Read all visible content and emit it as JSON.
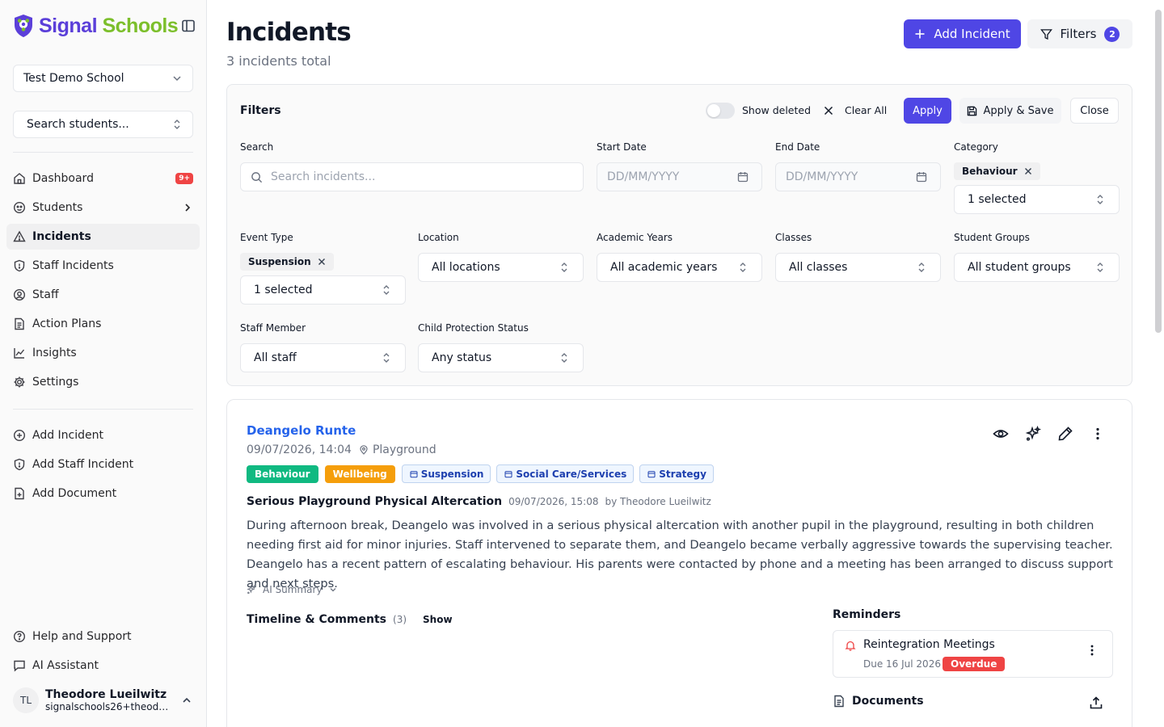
{
  "brand": {
    "name_part1": "Signal",
    "name_part2": "Schools",
    "colors": {
      "primary": "#5b3fd9",
      "secondary": "#7cbf2b"
    }
  },
  "sidebar": {
    "school_select": "Test Demo School",
    "student_search": "Search students...",
    "nav": [
      {
        "label": "Dashboard",
        "icon": "home-icon",
        "badge": "9+"
      },
      {
        "label": "Students",
        "icon": "students-icon"
      },
      {
        "label": "Incidents",
        "icon": "alert-triangle-icon",
        "active": true
      },
      {
        "label": "Staff Incidents",
        "icon": "shield-icon"
      },
      {
        "label": "Staff",
        "icon": "user-circle-icon"
      },
      {
        "label": "Action Plans",
        "icon": "file-text-icon"
      },
      {
        "label": "Insights",
        "icon": "chart-line-icon"
      },
      {
        "label": "Settings",
        "icon": "gear-icon"
      }
    ],
    "quick_actions": [
      {
        "label": "Add Incident",
        "icon": "plus-circle-icon"
      },
      {
        "label": "Add Staff Incident",
        "icon": "shield-icon"
      },
      {
        "label": "Add Document",
        "icon": "file-plus-icon"
      }
    ],
    "footer": [
      {
        "label": "Help and Support",
        "icon": "help-circle-icon"
      },
      {
        "label": "AI Assistant",
        "icon": "message-icon"
      }
    ],
    "user": {
      "initials": "TL",
      "name": "Theodore Lueilwitz",
      "email": "signalschools26+theodore@example.com"
    }
  },
  "header": {
    "title": "Incidents",
    "subtitle": "3 incidents total",
    "add_button": "Add Incident",
    "filters_button": "Filters",
    "filters_count": "2",
    "accent_color": "#4f46e5"
  },
  "filters": {
    "title": "Filters",
    "show_deleted_label": "Show deleted",
    "show_deleted": false,
    "clear_all": "Clear All",
    "apply": "Apply",
    "apply_save": "Apply & Save",
    "close": "Close",
    "search_label": "Search",
    "search_placeholder": "Search incidents...",
    "start_date_label": "Start Date",
    "start_date_placeholder": "DD/MM/YYYY",
    "end_date_label": "End Date",
    "end_date_placeholder": "DD/MM/YYYY",
    "category_label": "Category",
    "category_chip": "Behaviour",
    "category_value": "1 selected",
    "event_type_label": "Event Type",
    "event_type_chip": "Suspension",
    "event_type_value": "1 selected",
    "location_label": "Location",
    "location_value": "All locations",
    "academic_years_label": "Academic Years",
    "academic_years_value": "All academic years",
    "classes_label": "Classes",
    "classes_value": "All classes",
    "student_groups_label": "Student Groups",
    "student_groups_value": "All student groups",
    "staff_member_label": "Staff Member",
    "staff_member_value": "All staff",
    "cp_status_label": "Child Protection Status",
    "cp_status_value": "Any status"
  },
  "incident": {
    "student": "Deangelo Runte",
    "datetime": "09/07/2026, 14:04",
    "location": "Playground",
    "tags_solid": [
      {
        "label": "Behaviour",
        "color": "#10b981"
      },
      {
        "label": "Wellbeing",
        "color": "#f59e0b"
      }
    ],
    "tags_outline": [
      "Suspension",
      "Social Care/Services",
      "Strategy"
    ],
    "title": "Serious Playground Physical Altercation",
    "logged_at": "09/07/2026, 15:08",
    "logged_by": "by Theodore Lueilwitz",
    "body": "During afternoon break, Deangelo was involved in a serious physical altercation with another pupil in the playground, resulting in both children needing first aid for minor injuries. Staff intervened to separate them, and Deangelo became verbally aggressive towards the supervising teacher. Deangelo has a recent pattern of escalating behaviour. His parents were contacted by phone and a meeting has been arranged to discuss support and next steps.",
    "ai_summary": "AI Summary",
    "timeline_title": "Timeline & Comments",
    "timeline_count": "(3)",
    "timeline_show": "Show",
    "reminders_title": "Reminders",
    "reminder": {
      "name": "Reintegration Meetings",
      "due": "Due 16 Jul 2026",
      "status": "Overdue"
    },
    "documents_title": "Documents"
  }
}
